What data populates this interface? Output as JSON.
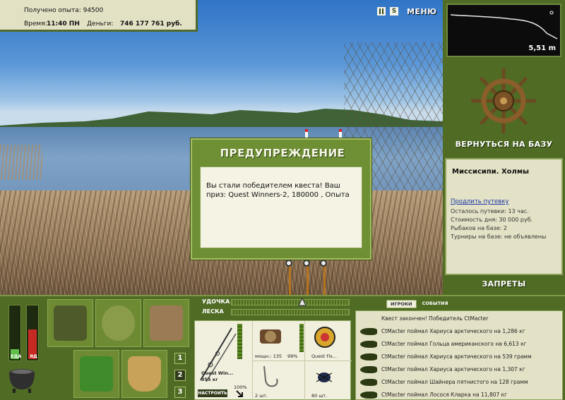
{
  "info": {
    "experience": "Получено опыта: 94500",
    "time_label": "Время:",
    "time_value": "11:40 ПН",
    "money_label": "Деньги:",
    "money_value": "746 177 761 руб."
  },
  "top_bar": {
    "pause_icon": "pause-icon",
    "settings_label": "S",
    "menu_label": "МЕНЮ"
  },
  "depth": {
    "value": "5,51 m"
  },
  "base": {
    "return_label": "ВЕРНУТЬСЯ НА БАЗУ",
    "location_name": "Миссисипи. Холмы",
    "extend_link": "Продлить путевку",
    "lines": [
      "Осталось путевки: 13 час.",
      "Стоимость дня: 30 000 руб.",
      "Рыбаков на базе: 2",
      "Турниры на базе: не объявлены"
    ],
    "bans_label": "ЗАПРЕТЫ"
  },
  "dialog": {
    "title": "ПРЕДУПРЕЖДЕНИЕ",
    "message": "Вы стали победителем квеста! Ваш приз: Quest Winners-2, 180000 , Опыта"
  },
  "status": {
    "food_label": "ЕДА",
    "poison_label": "ЯД",
    "food_level": 0.18,
    "poison_level": 0.55
  },
  "pages": [
    "1",
    "2",
    "3"
  ],
  "tackle": {
    "rod_label": "УДОЧКА",
    "line_label": "ЛЕСКА",
    "rod_name": "Quest Win...",
    "rod_weight": "355 кг",
    "rod_percent": "100%",
    "reel_caption": "мощн.: 135",
    "reel_percent": "99%",
    "line_caption": "Quest Fis...",
    "hook_caption": "2 шт.",
    "bait_caption": "80 шт.",
    "adjust_label": "НАСТРОИТЬ"
  },
  "log": {
    "tab_players": "ИГРОКИ",
    "tab_events": "СОБЫТИЯ",
    "header": "Квест закончен! Победитель CtMacter",
    "entries": [
      "CtMacter поймал Хариуса арктического на 1,286 кг",
      "CtMacter поймал Гольца американского на 6,613 кг",
      "CtMacter поймал Хариуса арктического на 539 грамм",
      "CtMacter поймал Хариуса арктического на 1,307 кг",
      "CtMacter поймал Шайнера пятнистого на 128 грамм",
      "CtMacter поймал Лосося Кларка на 11,807 кг"
    ]
  }
}
